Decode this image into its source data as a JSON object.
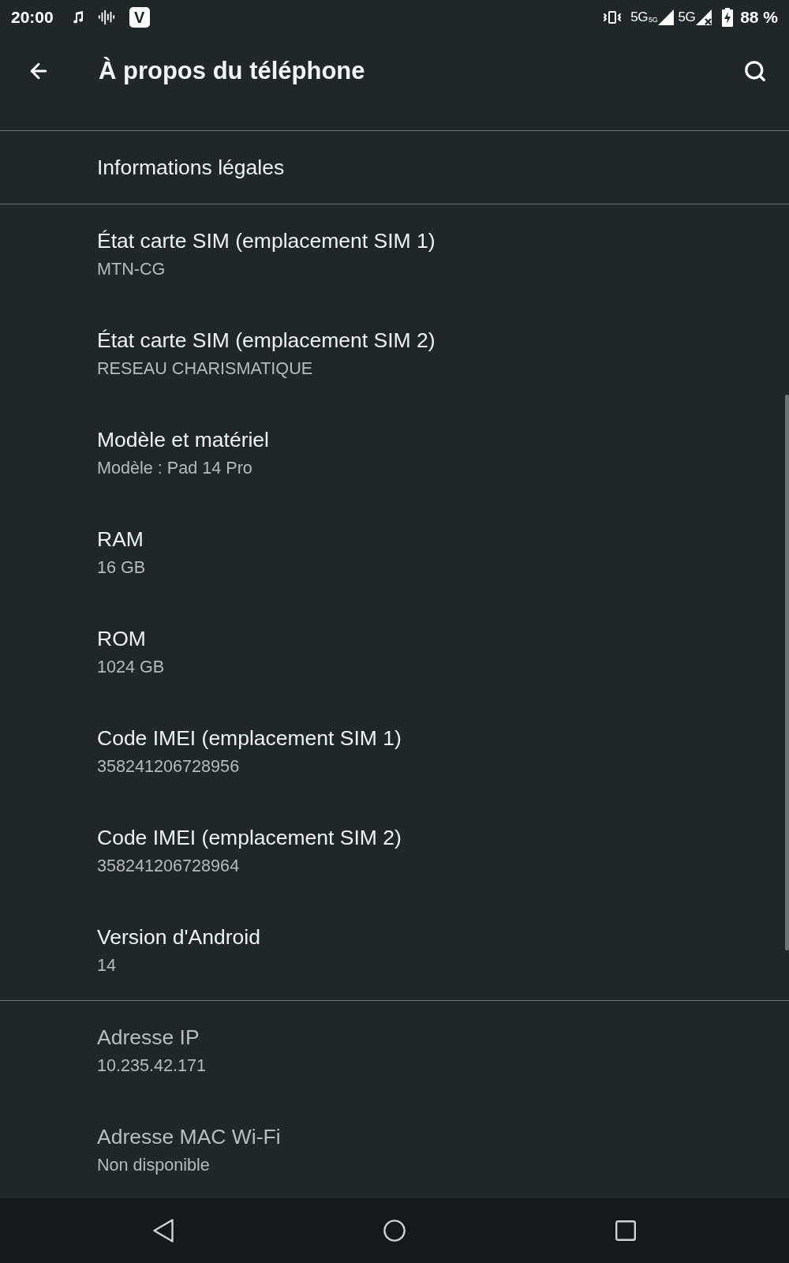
{
  "status_bar": {
    "time": "20:00",
    "notification_icons": [
      {
        "kind": "music"
      },
      {
        "kind": "waveform"
      },
      {
        "kind": "app",
        "label": "V"
      }
    ],
    "system_icons": [
      {
        "kind": "vibrate"
      },
      {
        "kind": "signal",
        "label": "5G",
        "badge": "5G"
      },
      {
        "kind": "signal-off",
        "label": "5G"
      },
      {
        "kind": "battery-charging"
      }
    ],
    "battery_text": "88 %"
  },
  "app_bar": {
    "title": "À propos du téléphone"
  },
  "sections": [
    {
      "items": [
        {
          "title": "Informations légales",
          "disabled": false
        }
      ]
    },
    {
      "items": [
        {
          "title": "État carte SIM (emplacement SIM 1)",
          "value": "MTN-CG",
          "disabled": false
        },
        {
          "title": "État carte SIM (emplacement SIM 2)",
          "value": "RESEAU CHARISMATIQUE",
          "disabled": false
        },
        {
          "title": "Modèle et matériel",
          "value": "Modèle : Pad 14 Pro",
          "disabled": false
        },
        {
          "title": "RAM",
          "value": "16 GB",
          "disabled": false
        },
        {
          "title": "ROM",
          "value": "1024 GB",
          "disabled": false
        },
        {
          "title": "Code IMEI (emplacement SIM 1)",
          "value": "358241206728956",
          "disabled": false
        },
        {
          "title": "Code IMEI (emplacement SIM 2)",
          "value": "358241206728964",
          "disabled": false
        },
        {
          "title": "Version d'Android",
          "value": "14",
          "disabled": false
        }
      ]
    },
    {
      "items": [
        {
          "title": "Adresse IP",
          "value": "10.235.42.171",
          "disabled": true
        },
        {
          "title": "Adresse MAC Wi-Fi",
          "value": "Non disponible",
          "disabled": true
        }
      ]
    }
  ],
  "nav_bar": {
    "buttons": [
      {
        "kind": "back"
      },
      {
        "kind": "home"
      },
      {
        "kind": "recents"
      }
    ]
  }
}
